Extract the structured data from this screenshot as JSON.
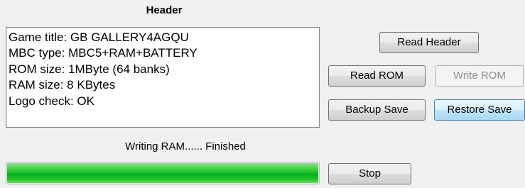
{
  "header_section": {
    "title": "Header",
    "lines": [
      "Game title: GB GALLERY4AGQU",
      "MBC type: MBC5+RAM+BATTERY",
      "ROM size: 1MByte (64 banks)",
      "RAM size: 8 KBytes",
      "Logo check: OK"
    ]
  },
  "buttons": {
    "read_header": "Read Header",
    "read_rom": "Read ROM",
    "write_rom": "Write ROM",
    "backup_save": "Backup Save",
    "restore_save": "Restore Save",
    "stop": "Stop"
  },
  "status": {
    "text": "Writing RAM...... Finished",
    "progress_fraction": 1.0
  },
  "colors": {
    "progress_green": "#06b025",
    "highlight_button": "#bee6fd"
  }
}
